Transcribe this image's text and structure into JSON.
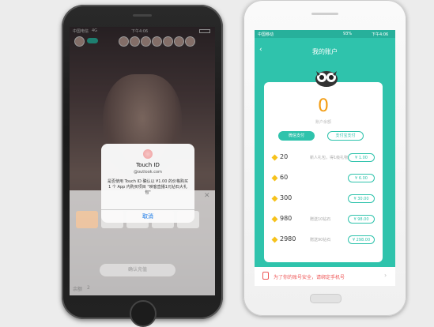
{
  "left_phone": {
    "status": {
      "carrier": "中国电信",
      "network": "4G",
      "time": "下午4:06"
    },
    "touch_id_alert": {
      "title": "Touch ID",
      "account": "@outlook.com",
      "message": "是否使用 Touch ID 确认以 ¥1.00 的价格购买 1 个 App 内购买项目 \"映客直播1元钻石大礼包\"",
      "cancel_label": "取消"
    },
    "sheet": {
      "confirm_label": "确认充值",
      "balance_label": "余额",
      "balance_value": "2"
    }
  },
  "right_phone": {
    "status": {
      "carrier": "中国移动",
      "battery": "93%",
      "time": "下午4:06"
    },
    "title": "我的账户",
    "balance": "0",
    "balance_label": "账户余额",
    "tabs": [
      {
        "label": "微信支付",
        "selected": true
      },
      {
        "label": "支付宝支付",
        "selected": false
      }
    ],
    "packages": [
      {
        "amount": "20",
        "bonus": "新人礼包，得1级礼物",
        "price": "¥ 1.00"
      },
      {
        "amount": "60",
        "bonus": "",
        "price": "¥ 6.00"
      },
      {
        "amount": "300",
        "bonus": "",
        "price": "¥ 30.00"
      },
      {
        "amount": "980",
        "bonus": "赠送10钻石",
        "price": "¥ 98.00"
      },
      {
        "amount": "2980",
        "bonus": "赠送90钻石",
        "price": "¥ 298.00"
      }
    ],
    "notice": "为了你的账号安全，请绑定手机号"
  },
  "colors": {
    "teal": "#2fc3ac",
    "balance_orange": "#f39c12",
    "link_blue": "#1677e6",
    "notice_red": "#e55555"
  }
}
